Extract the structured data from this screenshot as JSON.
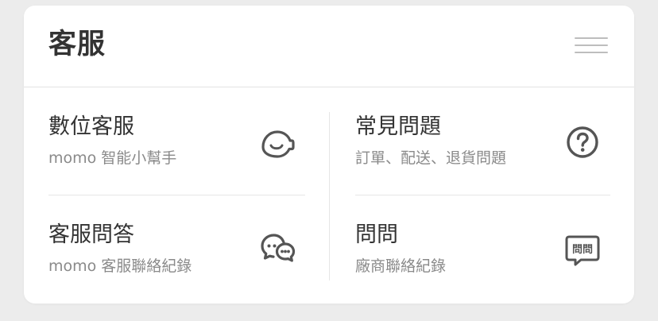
{
  "header": {
    "title": "客服",
    "menu_icon": "hamburger-menu-icon"
  },
  "items": [
    {
      "title": "數位客服",
      "subtitle": "momo 智能小幫手",
      "icon": "chatbot-face-icon"
    },
    {
      "title": "常見問題",
      "subtitle": "訂單、配送、退貨問題",
      "icon": "question-circle-icon"
    },
    {
      "title": "客服問答",
      "subtitle": "momo 客服聯絡紀錄",
      "icon": "chat-bubbles-icon"
    },
    {
      "title": "問問",
      "subtitle": "廠商聯絡紀錄",
      "icon": "wenwen-speech-icon",
      "icon_text": "問問"
    }
  ],
  "colors": {
    "background": "#ececec",
    "card": "#ffffff",
    "title_text": "#333333",
    "subtitle_text": "#8a8a8a",
    "icon": "#555555",
    "divider": "#e6e6e6"
  }
}
